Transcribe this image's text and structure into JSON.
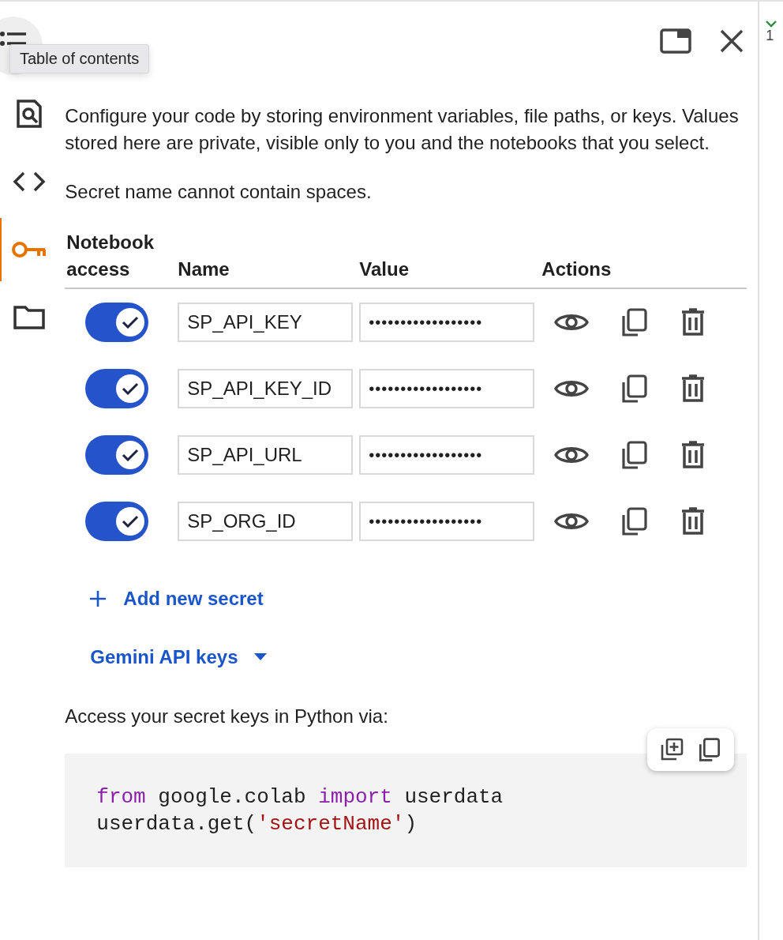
{
  "tooltip": "Table of contents",
  "rail": [
    {
      "kind": "toc",
      "selected": false
    },
    {
      "kind": "search",
      "selected": false
    },
    {
      "kind": "code",
      "selected": false
    },
    {
      "kind": "key",
      "selected": true
    },
    {
      "kind": "folder",
      "selected": false
    }
  ],
  "description": "Configure your code by storing environment variables, file paths, or keys. Values stored here are private, visible only to you and the notebooks that you select.",
  "error": "Secret name cannot contain spaces.",
  "columns": [
    "Notebook access",
    "Name",
    "Value",
    "Actions"
  ],
  "secrets": [
    {
      "on": true,
      "name": "SP_API_KEY",
      "value": "••••••••••••••••••"
    },
    {
      "on": true,
      "name": "SP_API_KEY_ID",
      "value": "••••••••••••••••••"
    },
    {
      "on": true,
      "name": "SP_API_URL",
      "value": "••••••••••••••••••"
    },
    {
      "on": true,
      "name": "SP_ORG_ID",
      "value": "••••••••••••••••••"
    }
  ],
  "add_button": "Add new secret",
  "gemini_menu": "Gemini API keys",
  "access_note": "Access your secret keys in Python via:",
  "code": [
    [
      {
        "kind": "keyword",
        "text": "from"
      },
      {
        "kind": "plain",
        "text": " google.colab "
      },
      {
        "kind": "keyword",
        "text": "import"
      },
      {
        "kind": "plain",
        "text": " userdata"
      }
    ],
    [
      {
        "kind": "plain",
        "text": "userdata.get("
      },
      {
        "kind": "string",
        "text": "'secretName'"
      },
      {
        "kind": "plain",
        "text": ")"
      }
    ]
  ],
  "side_strip": {
    "text": "1"
  }
}
